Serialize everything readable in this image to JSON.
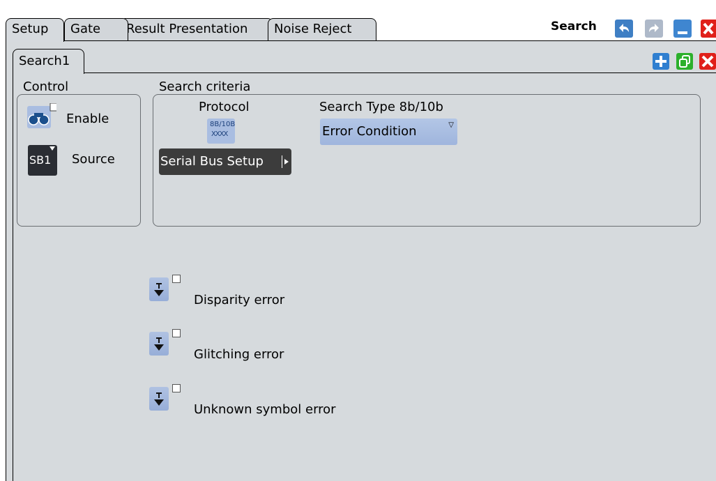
{
  "tabs": [
    {
      "label": "Setup",
      "active": true
    },
    {
      "label": "Gate",
      "active": false
    },
    {
      "label": "Result Presentation",
      "active": false
    },
    {
      "label": "Noise Reject",
      "active": false
    }
  ],
  "window": {
    "title": "Search"
  },
  "sub_tab": {
    "label": "Search1"
  },
  "control": {
    "label": "Control",
    "enable_label": "Enable",
    "enable_checked": false,
    "source_label": "Source",
    "source_value": "SB1"
  },
  "criteria": {
    "label": "Search criteria",
    "protocol_label": "Protocol",
    "protocol_icon_text_top": "8B/10B",
    "protocol_icon_text_bottom": "XXXX",
    "serial_bus_button": "Serial Bus Setup",
    "search_type_label": "Search Type 8b/10b",
    "search_type_value": "Error Condition"
  },
  "errors": [
    {
      "label": "Disparity error",
      "checked": false
    },
    {
      "label": "Glitching error",
      "checked": false
    },
    {
      "label": "Unknown symbol error",
      "checked": false
    }
  ],
  "colors": {
    "panel_bg": "#d6dadd",
    "accent_blue": "#3a80c8",
    "add_blue": "#2f7fd0",
    "copy_green": "#2bb02b",
    "close_red": "#e0201a",
    "dark_button": "#3c3c3c",
    "dropdown_blue": "#a9bde1"
  }
}
